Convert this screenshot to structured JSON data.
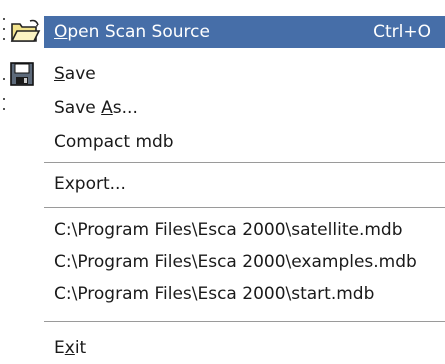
{
  "menu": {
    "items": [
      {
        "label_pre": "",
        "label_mnemonic": "O",
        "label_post": "pen Scan Source",
        "shortcut": "Ctrl+O",
        "icon": "open-folder-icon",
        "highlighted": true
      },
      {
        "label_pre": "",
        "label_mnemonic": "S",
        "label_post": "ave",
        "icon": "floppy-disk-icon"
      },
      {
        "label_pre": "Save ",
        "label_mnemonic": "A",
        "label_post": "s..."
      },
      {
        "label": "Compact mdb"
      },
      {
        "label": "Export..."
      },
      {
        "label": "C:\\Program Files\\Esca 2000\\satellite.mdb"
      },
      {
        "label": "C:\\Program Files\\Esca 2000\\examples.mdb"
      },
      {
        "label": "C:\\Program Files\\Esca 2000\\start.mdb"
      },
      {
        "label_pre": "E",
        "label_mnemonic": "x",
        "label_post": "it"
      }
    ]
  },
  "colors": {
    "highlight": "#466ea8",
    "text": "#1a1a1a",
    "separator": "#9a9a9a"
  }
}
